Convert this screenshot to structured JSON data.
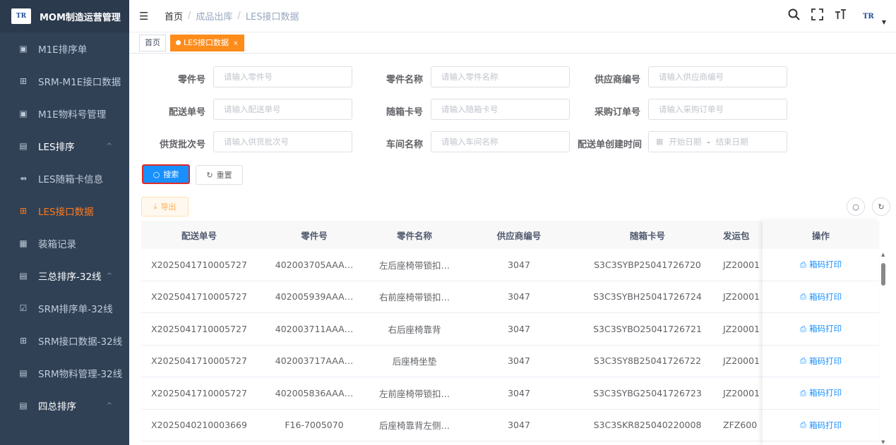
{
  "brand": {
    "logo_text": "TR",
    "title": "MOM制造运营管理"
  },
  "sidebar": {
    "items": [
      {
        "label": "M1E排序单",
        "icon": "▣"
      },
      {
        "label": "SRM-M1E接口数据",
        "icon": "⊞"
      },
      {
        "label": "M1E物料号管理",
        "icon": "▣"
      },
      {
        "label": "LES排序",
        "icon": "▤",
        "caret": "^"
      },
      {
        "label": "LES随箱卡信息",
        "icon": "⇴"
      },
      {
        "label": "LES接口数据",
        "icon": "⊞"
      },
      {
        "label": "装箱记录",
        "icon": "▦"
      },
      {
        "label": "三总排序-32线",
        "icon": "▤",
        "caret": "^"
      },
      {
        "label": "SRM排序单-32线",
        "icon": "☑"
      },
      {
        "label": "SRM接口数据-32线",
        "icon": "⊞"
      },
      {
        "label": "SRM物料管理-32线",
        "icon": "▤"
      },
      {
        "label": "四总排序",
        "icon": "▤",
        "caret": "^"
      }
    ]
  },
  "header": {
    "breadcrumb": {
      "home": "首页",
      "sep": "/",
      "level1": "成品出库",
      "current": "LES接口数据"
    }
  },
  "tags": {
    "home": "首页",
    "active": "LES接口数据",
    "close": "×"
  },
  "form": {
    "part_no": {
      "label": "零件号",
      "placeholder": "请输入零件号"
    },
    "part_name": {
      "label": "零件名称",
      "placeholder": "请输入零件名称"
    },
    "supplier_no": {
      "label": "供应商编号",
      "placeholder": "请输入供应商编号"
    },
    "delivery_no": {
      "label": "配送单号",
      "placeholder": "请输入配送单号"
    },
    "card_no": {
      "label": "随箱卡号",
      "placeholder": "请输入随箱卡号"
    },
    "po_no": {
      "label": "采购订单号",
      "placeholder": "请输入采购订单号"
    },
    "batch_no": {
      "label": "供货批次号",
      "placeholder": "请输入供货批次号"
    },
    "workshop": {
      "label": "车间名称",
      "placeholder": "请输入车间名称"
    },
    "created_time": {
      "label": "配送单创建时间",
      "start": "开始日期",
      "dash": "-",
      "end": "结束日期"
    }
  },
  "buttons": {
    "search": "搜索",
    "reset": "重置",
    "export": "导出"
  },
  "table": {
    "headers": [
      "配送单号",
      "零件号",
      "零件名称",
      "供应商编号",
      "随箱卡号",
      "发运包"
    ],
    "op_header": "操作",
    "op_label": "箱码打印",
    "rows": [
      [
        "X2025041710005727",
        "402003705AAA…",
        "左后座椅带锁扣…",
        "3047",
        "S3C3SYBP25041726720",
        "JZ20001"
      ],
      [
        "X2025041710005727",
        "402005939AAA…",
        "右前座椅带锁扣…",
        "3047",
        "S3C3SYBH25041726724",
        "JZ20001"
      ],
      [
        "X2025041710005727",
        "402003711AAA…",
        "右后座椅靠背",
        "3047",
        "S3C3SYBO25041726721",
        "JZ20001"
      ],
      [
        "X2025041710005727",
        "402003717AAA…",
        "后座椅坐垫",
        "3047",
        "S3C3SY8B25041726722",
        "JZ20001"
      ],
      [
        "X2025041710005727",
        "402005836AAA…",
        "左前座椅带锁扣…",
        "3047",
        "S3C3SYBG25041726723",
        "JZ20001"
      ],
      [
        "X2025040210003669",
        "F16-7005070",
        "后座椅靠背左侧…",
        "3047",
        "S3C3SKR825040220008",
        "ZFZ600"
      ]
    ]
  },
  "colors": {
    "sidebar_bg": "#304156",
    "accent_orange": "#ff8c1a",
    "primary": "#1890ff"
  }
}
